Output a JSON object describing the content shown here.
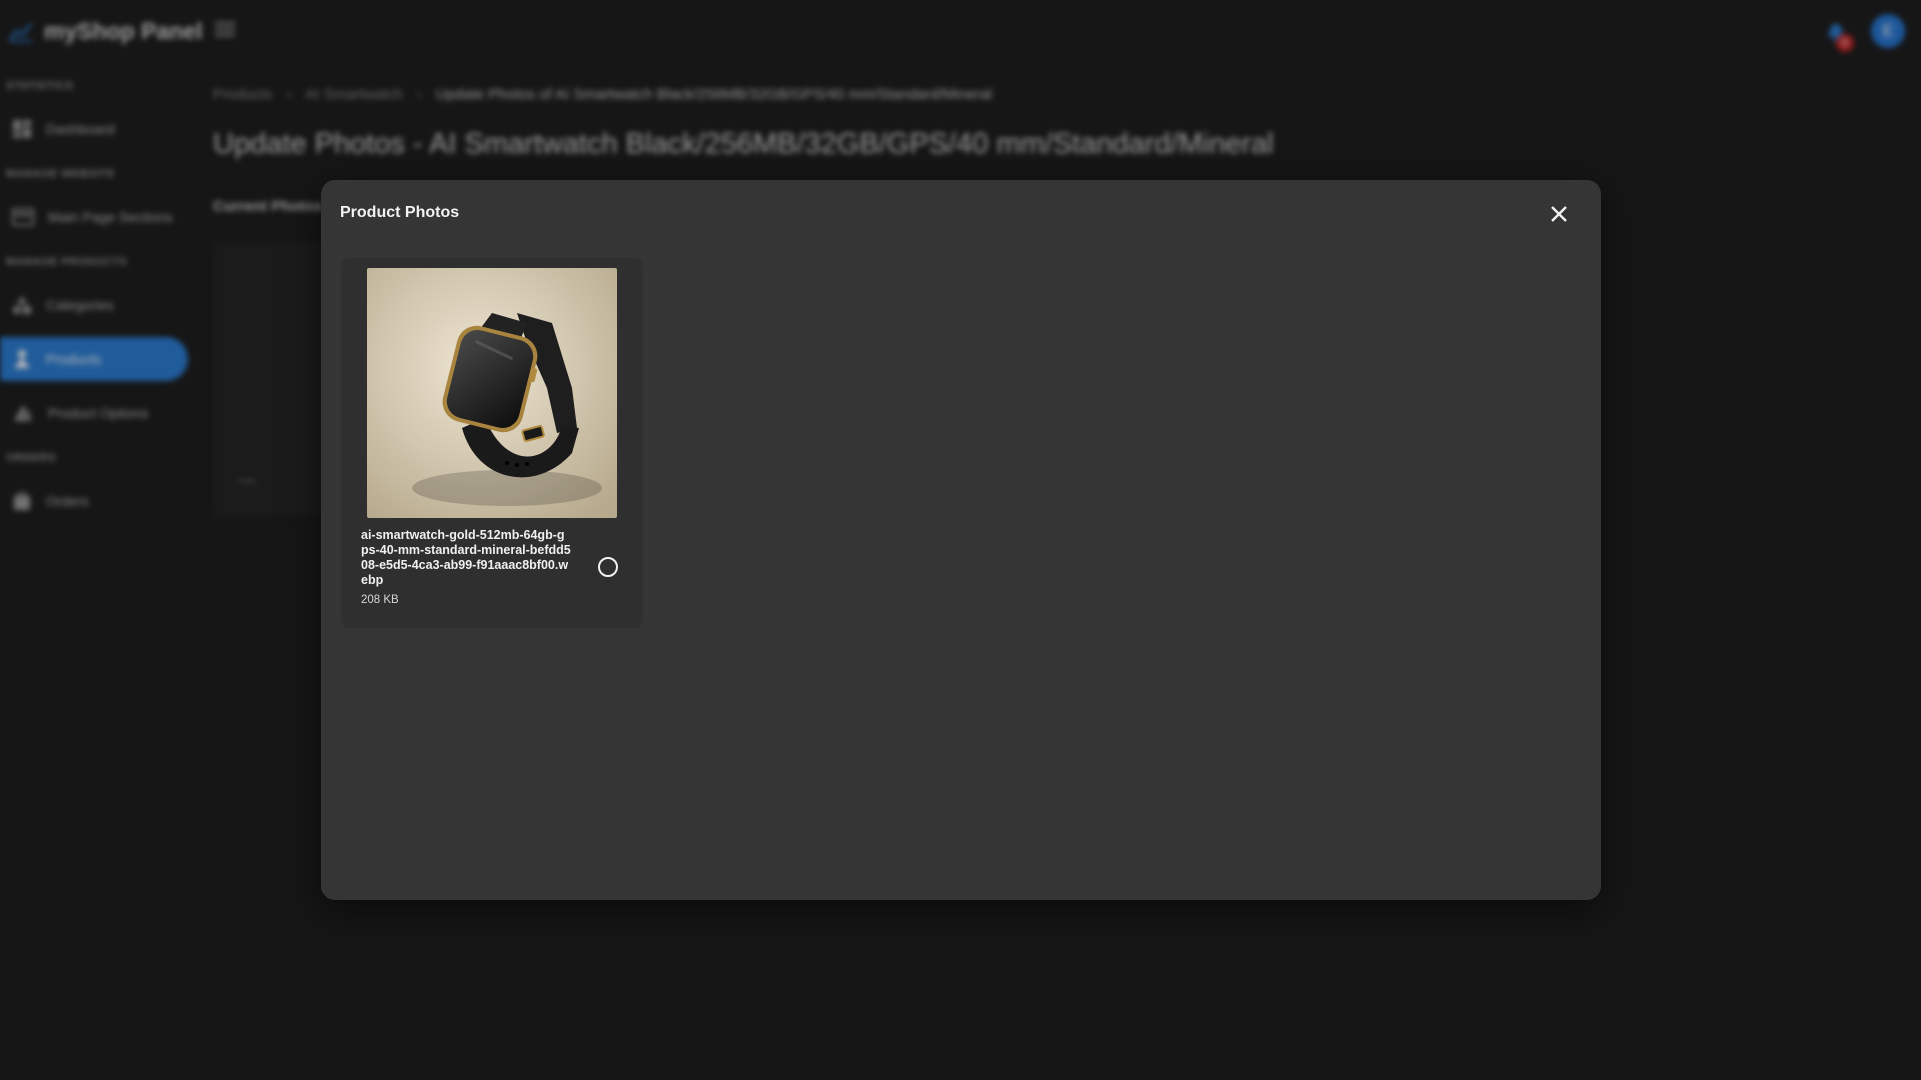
{
  "app": {
    "brand": "myShop Panel",
    "notification_count": "6",
    "avatar_initial": "E"
  },
  "sidebar": {
    "sections": [
      {
        "label": "STATISTICS"
      },
      {
        "label": "MANAGE WEBSITE"
      },
      {
        "label": "MANAGE PRODUCTS"
      },
      {
        "label": "ORDERS"
      }
    ],
    "items": [
      {
        "label": "Dashboard",
        "icon": "dashboard-icon"
      },
      {
        "label": "Main Page Sections",
        "icon": "web-icon"
      },
      {
        "label": "Categories",
        "icon": "category-icon"
      },
      {
        "label": "Products",
        "icon": "products-icon",
        "active": true
      },
      {
        "label": "Product Options",
        "icon": "options-icon"
      },
      {
        "label": "Orders",
        "icon": "orders-icon"
      }
    ]
  },
  "breadcrumb": {
    "items": [
      "Products",
      "AI Smartwatch",
      "Update Photos of AI Smartwatch Black/256MB/32GB/GPS/40 mm/Standard/Mineral"
    ]
  },
  "page": {
    "title": "Update Photos - AI Smartwatch Black/256MB/32GB/GPS/40 mm/Standard/Mineral",
    "current_photos_label": "Current Photos"
  },
  "dialog": {
    "title": "Product Photos",
    "photos": [
      {
        "filename": "ai-smartwatch-gold-512mb-64gb-gps-40-mm-standard-mineral-befdd508-e5d5-4ca3-ab99-f91aaac8bf00.webp",
        "size": "208 KB",
        "selected": false
      }
    ]
  },
  "colors": {
    "accent": "#2d7fd6",
    "dialog_bg": "#353535",
    "page_bg": "#1f1f1f",
    "badge": "#c62828"
  }
}
